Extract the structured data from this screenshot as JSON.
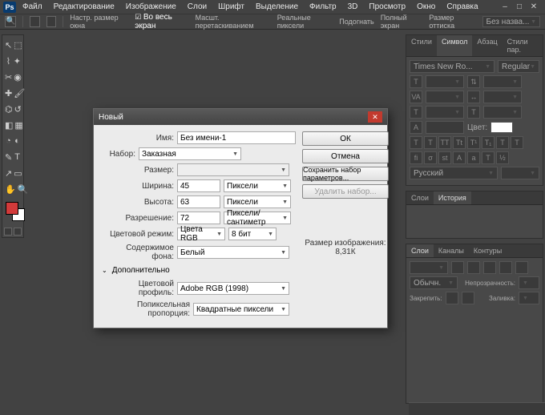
{
  "menubar": {
    "logo": "Ps",
    "items": [
      "Файл",
      "Редактирование",
      "Изображение",
      "Слои",
      "Шрифт",
      "Выделение",
      "Фильтр",
      "3D",
      "Просмотр",
      "Окно",
      "Справка"
    ]
  },
  "optbar": {
    "label1": "Настр. размер окна",
    "label2": "Во весь экран",
    "label3": "Масшт. перетаскиванием",
    "label4": "Реальные пиксели",
    "label5": "Подогнать",
    "label6": "Полный экран",
    "label7": "Размер оттиска",
    "combo": "Без назва..."
  },
  "panels": {
    "p1": {
      "tabs": [
        "Стили",
        "Символ",
        "Абзац",
        "Стили пар."
      ],
      "active": 1,
      "font": "Times New Ro...",
      "style": "Regular",
      "color_lbl": "Цвет:"
    },
    "p2": {
      "tabs": [
        "Русский"
      ],
      "combo2": ""
    },
    "p3": {
      "tabs": [
        "Слои",
        "История"
      ],
      "active": 1
    },
    "p4": {
      "tabs": [
        "Слои",
        "Каналы",
        "Контуры"
      ],
      "active": 0,
      "blend": "Обычн.",
      "opacity_lbl": "Непрозрачность:",
      "lock_lbl": "Закрепить:",
      "fill_lbl": "Заливка:"
    }
  },
  "dialog": {
    "title": "Новый",
    "name_lbl": "Имя:",
    "name_val": "Без имени-1",
    "preset_lbl": "Набор:",
    "preset_val": "Заказная",
    "size_lbl": "Размер:",
    "size_val": "",
    "width_lbl": "Ширина:",
    "width_val": "45",
    "width_unit": "Пиксели",
    "height_lbl": "Высота:",
    "height_val": "63",
    "height_unit": "Пиксели",
    "res_lbl": "Разрешение:",
    "res_val": "72",
    "res_unit": "Пиксели/сантиметр",
    "mode_lbl": "Цветовой режим:",
    "mode_val": "Цвета RGB",
    "depth_val": "8 бит",
    "bg_lbl": "Содержимое фона:",
    "bg_val": "Белый",
    "advanced": "Дополнительно",
    "profile_lbl": "Цветовой профиль:",
    "profile_val": "Adobe RGB (1998)",
    "aspect_lbl": "Попиксельная пропорция:",
    "aspect_val": "Квадратные пиксели",
    "ok": "ОК",
    "cancel": "Отмена",
    "save": "Сохранить набор параметров...",
    "delete": "Удалить набор...",
    "imgsize_lbl": "Размер изображения:",
    "imgsize_val": "8,31К"
  }
}
